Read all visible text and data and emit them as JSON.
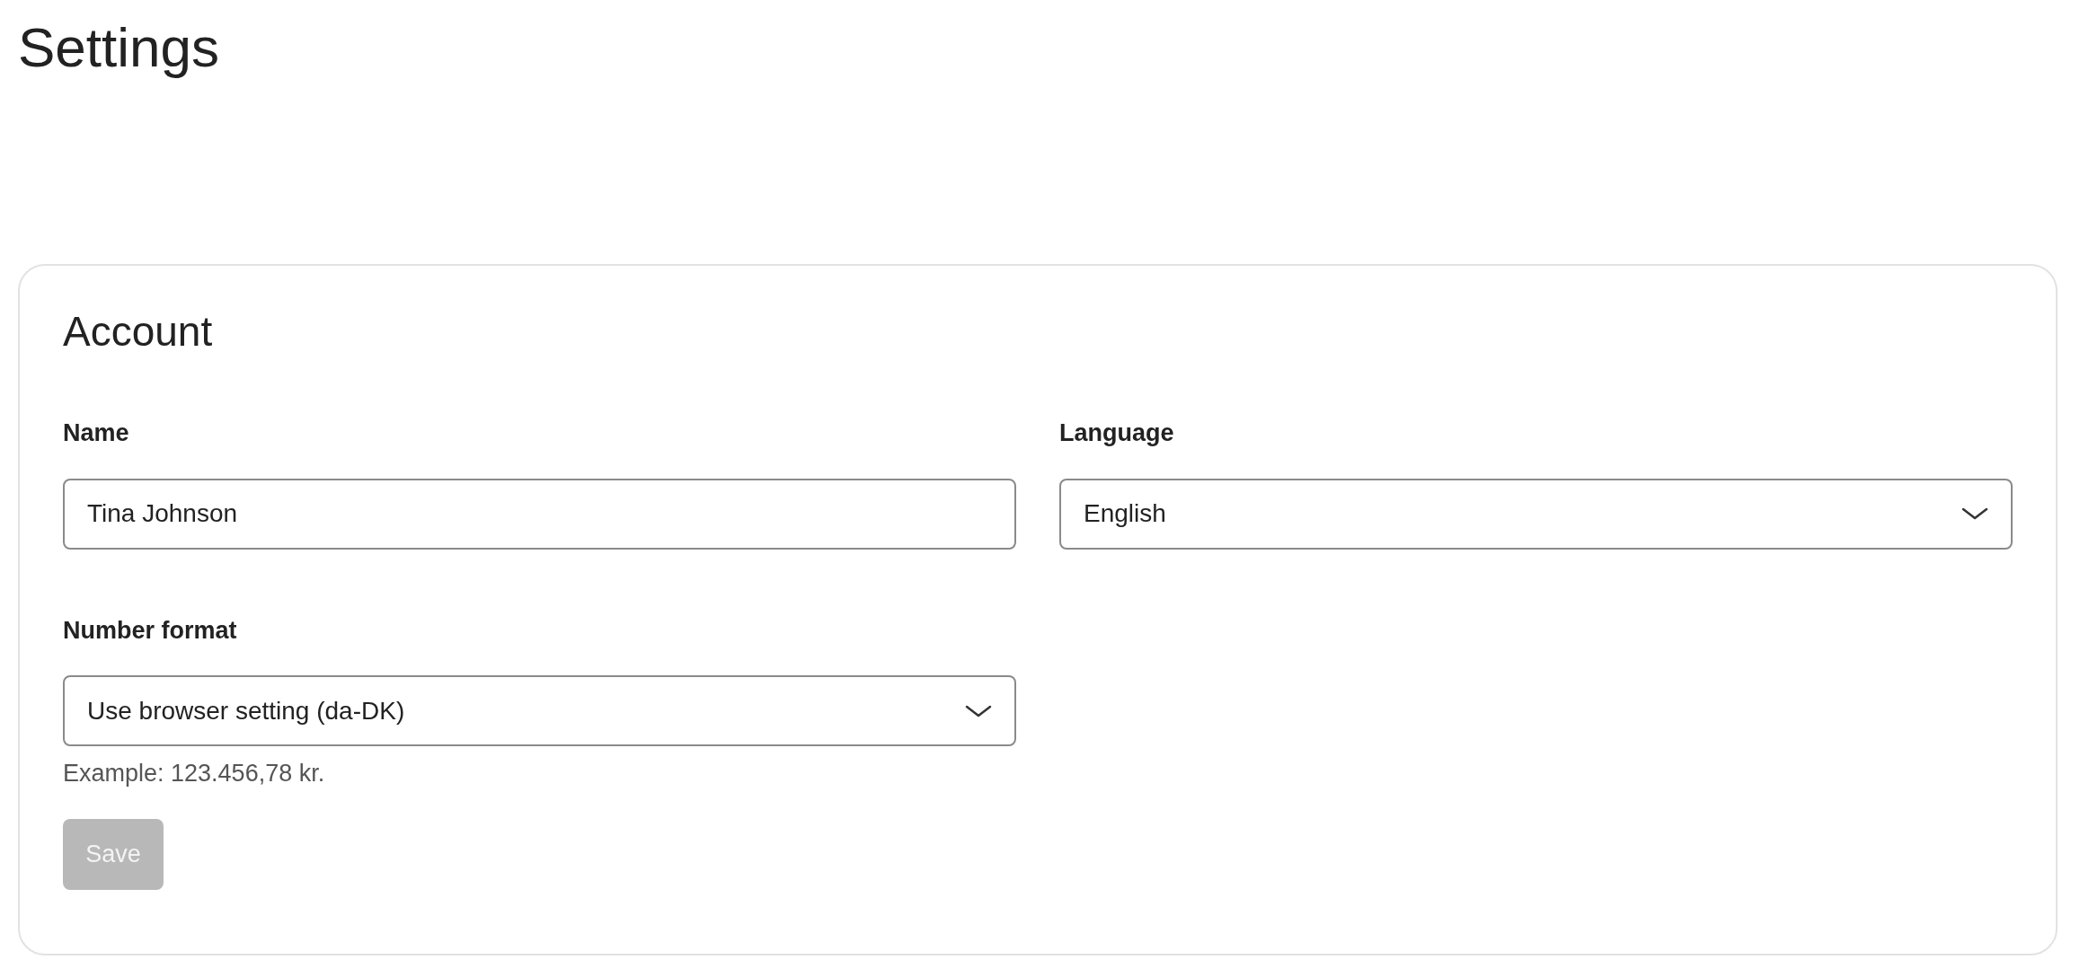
{
  "page": {
    "title": "Settings"
  },
  "account": {
    "title": "Account",
    "fields": [
      {
        "kind": "text",
        "label": "Name",
        "value": "Tina Johnson"
      },
      {
        "kind": "select",
        "label": "Language",
        "value": "English"
      },
      {
        "kind": "select",
        "label": "Number format",
        "value": "Use browser setting (da-DK)",
        "hint": "Example: 123.456,78 kr."
      }
    ],
    "save_button": {
      "label": "Save",
      "disabled": true
    }
  }
}
